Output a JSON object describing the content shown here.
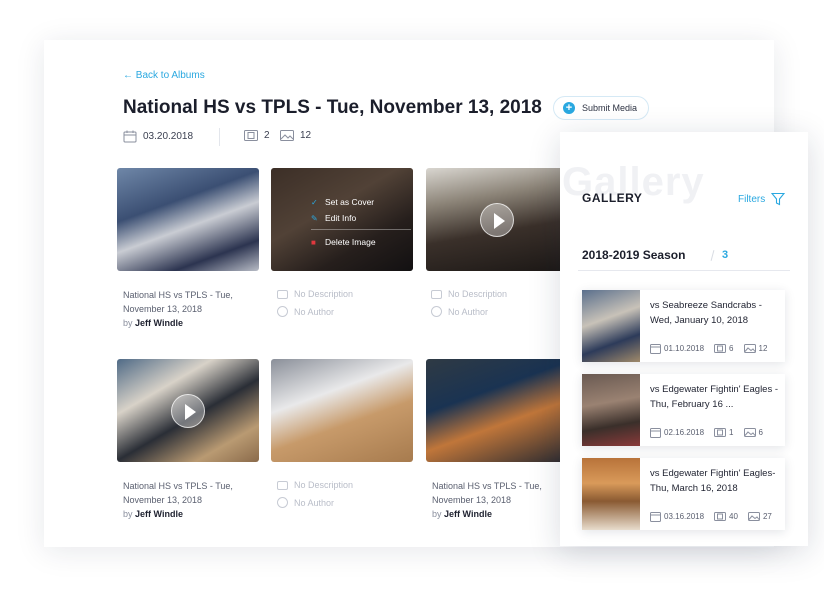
{
  "nav": {
    "back_label": "← Back to Albums"
  },
  "album": {
    "title": "National HS vs TPLS - Tue, November 13, 2018",
    "date": "03.20.2018",
    "video_count": "2",
    "photo_count": "12"
  },
  "submit_label": "Submit Media",
  "context_menu": {
    "set_cover": "Set as Cover",
    "edit_info": "Edit Info",
    "delete": "Delete Image"
  },
  "captions": {
    "title_line1": "National HS vs TPLS - Tue,",
    "title_line2": "November 13, 2018",
    "by": "by",
    "author": "Jeff Windle",
    "no_description": "No Description",
    "no_author": "No Author"
  },
  "gallery": {
    "ghost": "Gallery",
    "title": "GALLERY",
    "filters_label": "Filters",
    "season_label": "2018-2019 Season",
    "season_count": "3",
    "items": [
      {
        "name": "vs Seabreeze Sandcrabs - Wed, January 10, 2018",
        "date": "01.10.2018",
        "videos": "6",
        "photos": "12"
      },
      {
        "name": "vs Edgewater Fightin' Eagles - Thu, February 16 ...",
        "date": "02.16.2018",
        "videos": "1",
        "photos": "6"
      },
      {
        "name": "vs Edgewater Fightin' Eagles- Thu, March 16, 2018",
        "date": "03.16.2018",
        "videos": "40",
        "photos": "27"
      }
    ]
  },
  "colors": {
    "accent": "#2aa8e0",
    "delete": "#e0383e"
  }
}
